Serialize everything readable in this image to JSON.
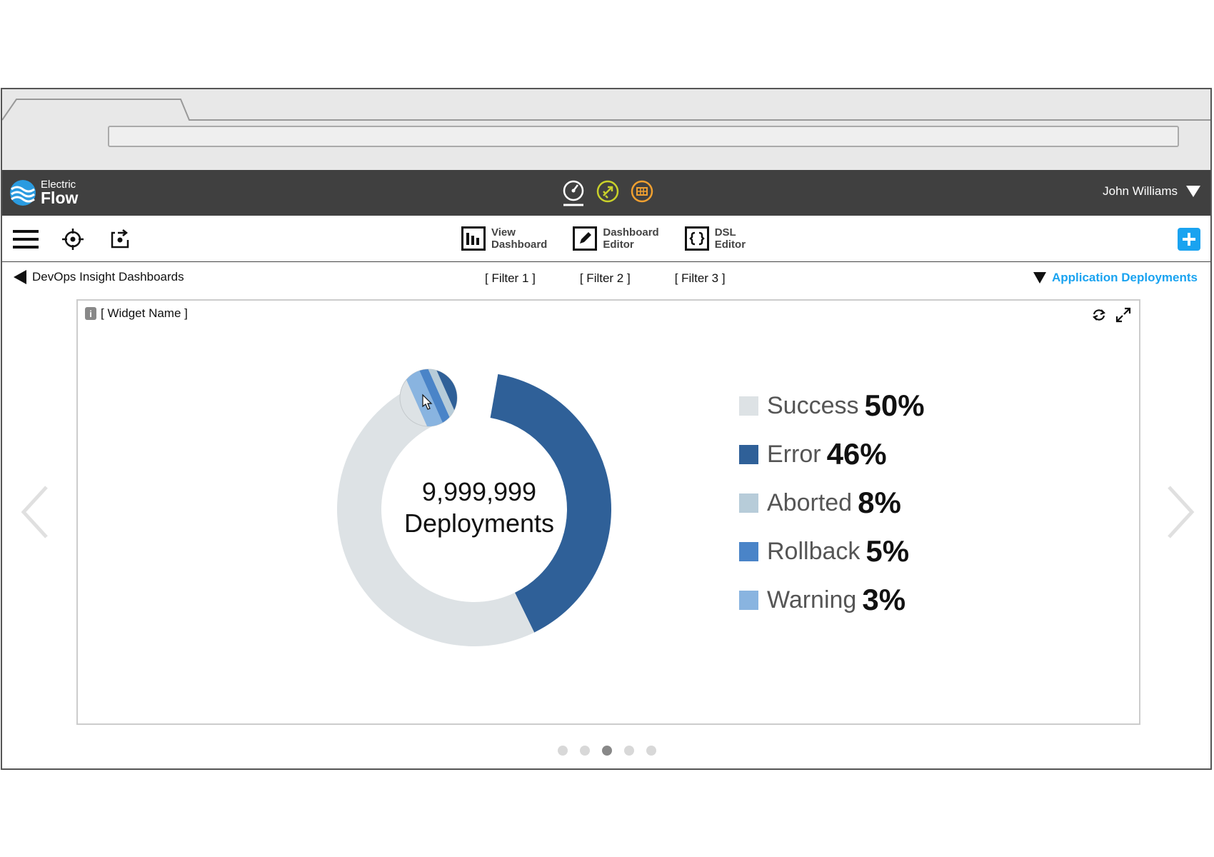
{
  "header": {
    "logo_small": "Electric",
    "logo_big": "Flow",
    "user_name": "John Williams",
    "apps": [
      "speedometer-icon",
      "rocket-icon",
      "grid-icon"
    ]
  },
  "toolbar": {
    "items": [
      {
        "label": "View\nDashboard",
        "icon": "bar-chart-icon"
      },
      {
        "label": "Dashboard\nEditor",
        "icon": "pencil-icon"
      },
      {
        "label": "DSL\nEditor",
        "icon": "braces-icon"
      }
    ]
  },
  "nav": {
    "back_label": "DevOps Insight Dashboards",
    "filters": [
      "[ Filter 1 ]",
      "[ Filter 2 ]",
      "[ Filter 3 ]"
    ],
    "app_select": "Application Deployments"
  },
  "widget": {
    "name": "[ Widget Name ]",
    "center_value": "9,999,999",
    "center_label": "Deployments"
  },
  "chart_data": {
    "type": "pie",
    "categories": [
      "Success",
      "Error",
      "Aborted",
      "Rollback",
      "Warning"
    ],
    "values": [
      50,
      46,
      8,
      5,
      3
    ],
    "value_labels": [
      "50%",
      "46%",
      "8%",
      "5%",
      "3%"
    ],
    "colors": [
      "#dde2e5",
      "#2f6098",
      "#b7ccd9",
      "#4a84c8",
      "#89b4e0"
    ]
  },
  "pagination": {
    "count": 5,
    "active": 2
  },
  "colors": {
    "accent": "#1aa3f0",
    "topbar": "#404040"
  }
}
